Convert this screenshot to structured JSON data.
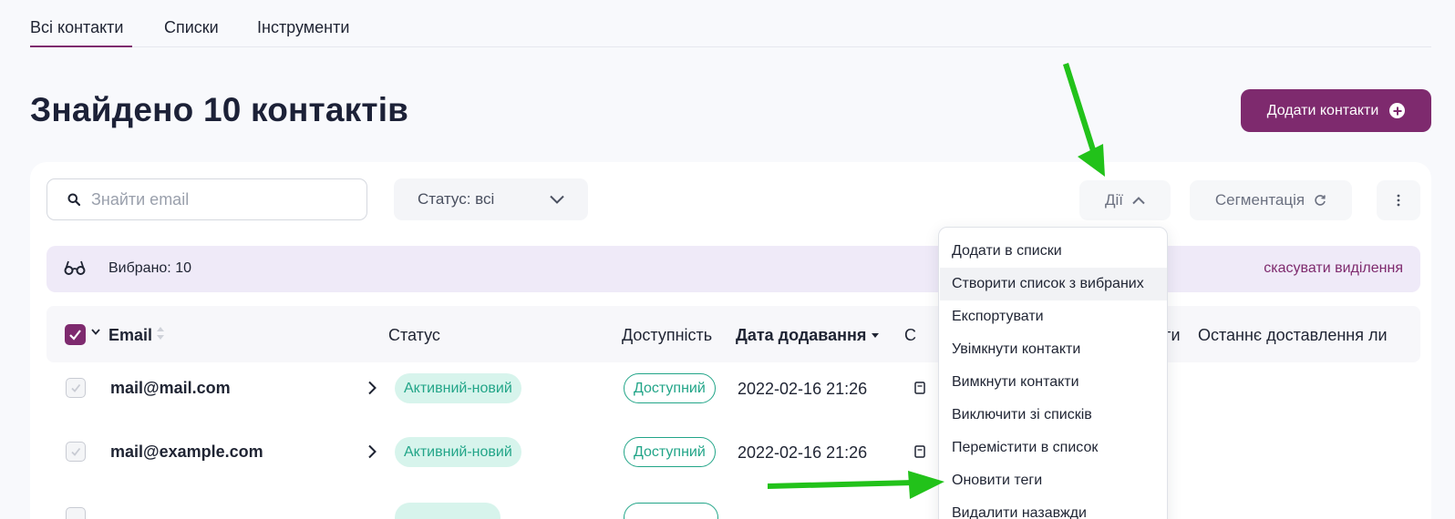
{
  "tabs": [
    {
      "label": "Всі контакти",
      "active": true
    },
    {
      "label": "Списки",
      "active": false
    },
    {
      "label": "Інструменти",
      "active": false
    }
  ],
  "page_title": "Знайдено 10 контактів",
  "add_button": {
    "label": "Додати контакти",
    "icon": "plus-circle-icon"
  },
  "search": {
    "placeholder": "Знайти email",
    "value": ""
  },
  "status_filter": {
    "label": "Статус: всі"
  },
  "toolbar": {
    "actions_label": "Дії",
    "segmentation_label": "Сегментація"
  },
  "selection": {
    "label": "Вибрано: 10",
    "cancel_label": "скасувати виділення"
  },
  "table": {
    "columns": [
      "Email",
      "Статус",
      "Доступність",
      "Дата додавання",
      "С",
      "Теги",
      "Останнє доставлення ли"
    ],
    "rows": [
      {
        "email": "mail@mail.com",
        "status": "Активний-новий",
        "availability": "Доступний",
        "date": "2022-02-16 21:26"
      },
      {
        "email": "mail@example.com",
        "status": "Активний-новий",
        "availability": "Доступний",
        "date": "2022-02-16 21:26"
      },
      {
        "email": "",
        "status": "",
        "availability": "",
        "date": ""
      }
    ]
  },
  "actions_menu": {
    "items": [
      "Додати в списки",
      "Створити список з вибраних",
      "Експортувати",
      "Увімкнути контакти",
      "Вимкнути контакти",
      "Виключити зі списків",
      "Перемістити в список",
      "Оновити теги",
      "Видалити назавжди"
    ],
    "highlighted_index": 1
  },
  "colors": {
    "brand": "#7e2a6e",
    "success": "#22a588",
    "success_bg": "#d7f4ec",
    "selection_bg": "#efeaf8",
    "annotation_arrow": "#22c21a"
  }
}
